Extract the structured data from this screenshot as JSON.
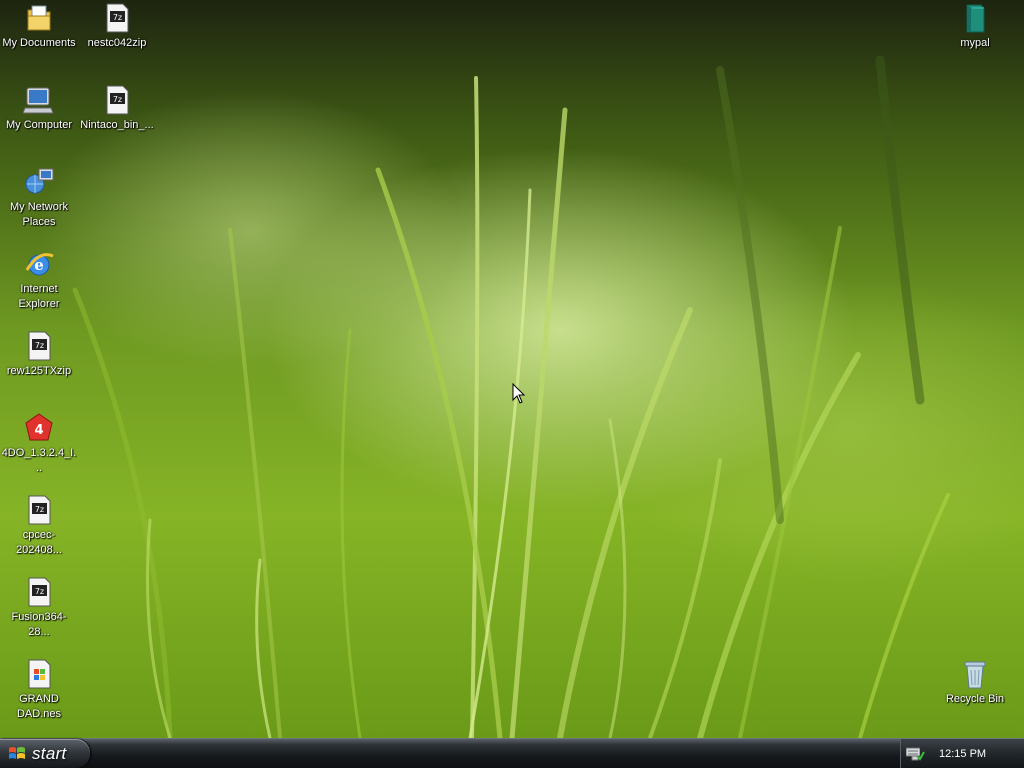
{
  "desktop": {
    "icons": [
      {
        "label": "My Documents",
        "icon": "my-documents-icon"
      },
      {
        "label": "nestc042zip",
        "icon": "7z-archive-icon"
      },
      {
        "label": "mypal",
        "icon": "mypal-browser-icon"
      },
      {
        "label": "My Computer",
        "icon": "my-computer-icon"
      },
      {
        "label": "Nintaco_bin_...",
        "icon": "7z-archive-icon"
      },
      {
        "label": "My Network Places",
        "icon": "network-places-icon"
      },
      {
        "label": "Internet Explorer",
        "icon": "internet-explorer-icon"
      },
      {
        "label": "rew125TXzip",
        "icon": "7z-archive-icon"
      },
      {
        "label": "4DO_1.3.2.4_I...",
        "icon": "4do-app-icon"
      },
      {
        "label": "cpcec-202408...",
        "icon": "7z-archive-icon"
      },
      {
        "label": "Fusion364-28...",
        "icon": "7z-archive-icon"
      },
      {
        "label": "GRAND DAD.nes",
        "icon": "nes-rom-file-icon"
      },
      {
        "label": "Recycle Bin",
        "icon": "recycle-bin-icon"
      }
    ]
  },
  "taskbar": {
    "start_label": "start",
    "clock": "12:15 PM"
  },
  "colors": {
    "taskbar": "#16191c",
    "wallpaper_green": "#86b426"
  }
}
